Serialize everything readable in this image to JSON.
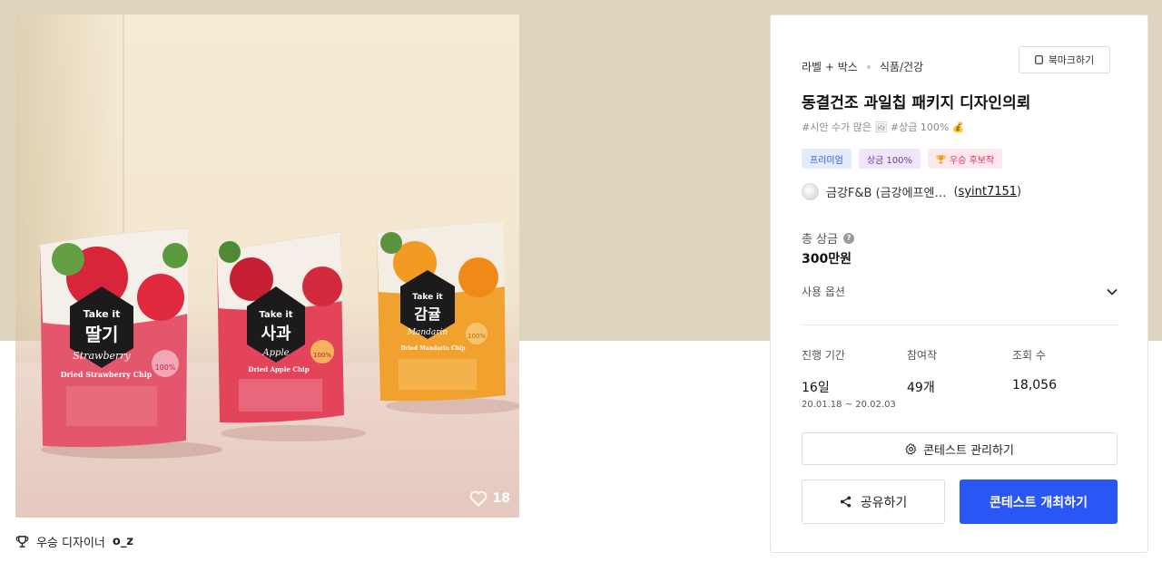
{
  "gallery": {
    "like_count": "18",
    "packages": [
      {
        "brand": "Take it",
        "name": "딸기",
        "script": "Strawberry",
        "chip": "Dried Strawberry Chip",
        "badge": "100%"
      },
      {
        "brand": "Take it",
        "name": "사과",
        "script": "Apple",
        "chip": "Dried Apple Chip",
        "badge": "100%"
      },
      {
        "brand": "Take it",
        "name": "감귤",
        "script": "Mandarin",
        "chip": "Dried Mandarin Chip",
        "badge": "100%"
      }
    ]
  },
  "winner_designer": {
    "prefix": "우승 디자이너",
    "name": "o_z"
  },
  "contest": {
    "category_primary": "라벨 + 박스",
    "category_secondary": "식품/건강",
    "bookmark_label": "북마크하기",
    "title": "동결건조 과일칩 패키지 디자인의뢰",
    "tags": "#시안 수가 많은 🖼  #상금 100% 💰",
    "badges": {
      "premium": "프리미엄",
      "prize": "상금 100%",
      "winner_candidate": "우승 후보작"
    },
    "host_name": "금강F&B (금강에프엔…",
    "host_id": "syint7151",
    "total_prize_label": "총 상금",
    "total_prize_value": "300만원",
    "usage_label": "사용 옵션",
    "stats": {
      "period_label": "진행 기간",
      "period_value": "16일",
      "period_dates": "20.01.18 ~ 20.02.03",
      "entries_label": "참여작",
      "entries_value": "49개",
      "views_label": "조회 수",
      "views_value": "18,056"
    },
    "manage_button": "콘테스트 관리하기",
    "share_button": "공유하기",
    "host_button": "콘테스트 개최하기"
  },
  "colors": {
    "hero_bg": "#ddd5bd",
    "primary": "#2a56f6",
    "premium_badge_text": "#2a56e8",
    "prize_badge_text": "#6a3ab0",
    "candidate_badge_text": "#d2335a"
  }
}
